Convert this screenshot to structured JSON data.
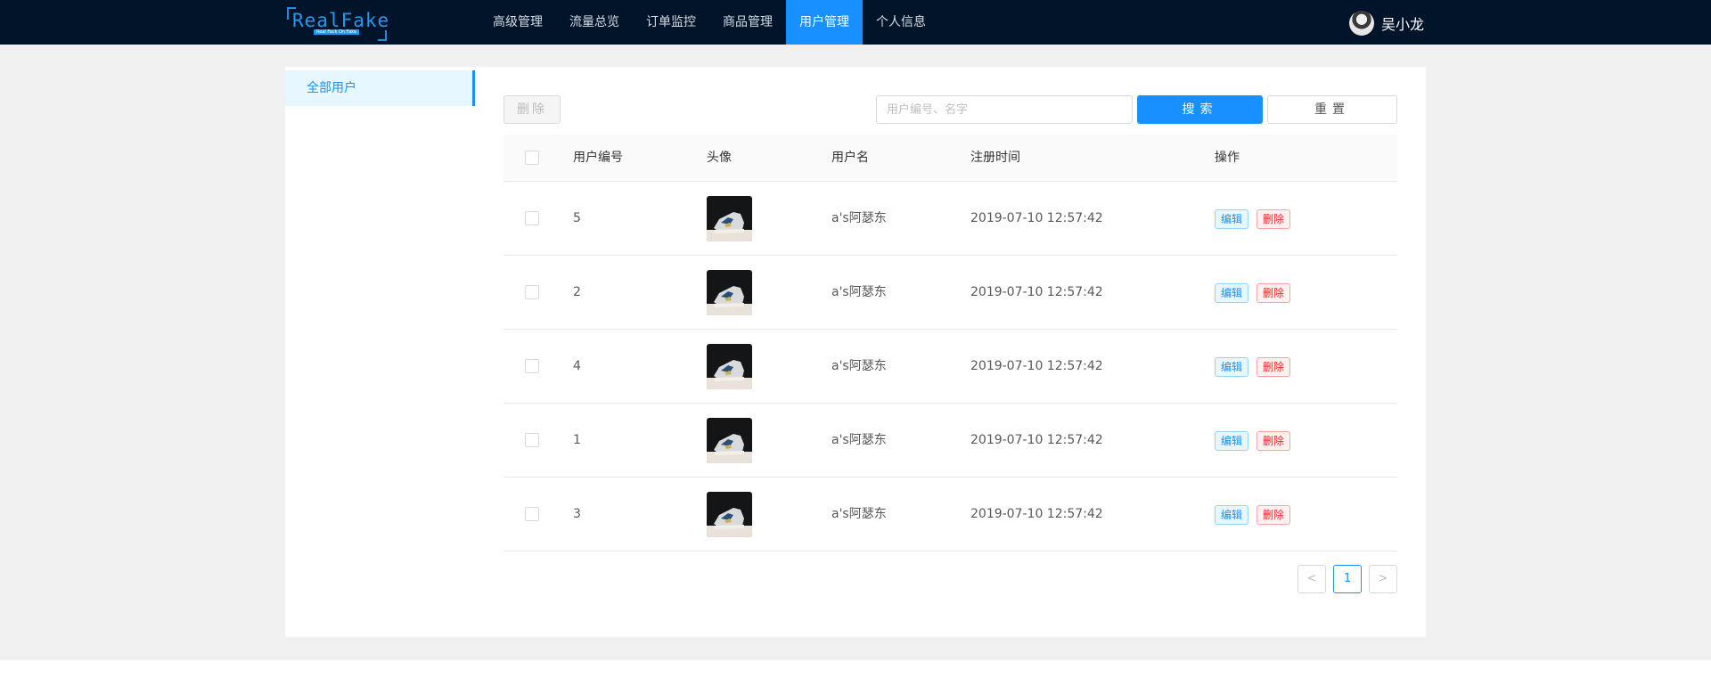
{
  "header": {
    "logo_text": "RealFake",
    "logo_subtext": "Real Fack On Fake",
    "nav": [
      {
        "label": "高级管理",
        "active": false
      },
      {
        "label": "流量总览",
        "active": false
      },
      {
        "label": "订单监控",
        "active": false
      },
      {
        "label": "商品管理",
        "active": false
      },
      {
        "label": "用户管理",
        "active": true
      },
      {
        "label": "个人信息",
        "active": false
      }
    ],
    "user_name": "吴小龙"
  },
  "sidebar": {
    "items": [
      {
        "label": "全部用户",
        "active": true
      }
    ]
  },
  "toolbar": {
    "delete_label": "删除",
    "search_placeholder": "用户编号、名字",
    "search_label": "搜索",
    "reset_label": "重置"
  },
  "table": {
    "columns": {
      "id": "用户编号",
      "avatar": "头像",
      "username": "用户名",
      "registered": "注册时间",
      "actions": "操作"
    },
    "rows": [
      {
        "id": "5",
        "username": "a's阿瑟东",
        "registered": "2019-07-10 12:57:42",
        "edit": "编辑",
        "delete": "删除"
      },
      {
        "id": "2",
        "username": "a's阿瑟东",
        "registered": "2019-07-10 12:57:42",
        "edit": "编辑",
        "delete": "删除"
      },
      {
        "id": "4",
        "username": "a's阿瑟东",
        "registered": "2019-07-10 12:57:42",
        "edit": "编辑",
        "delete": "删除"
      },
      {
        "id": "1",
        "username": "a's阿瑟东",
        "registered": "2019-07-10 12:57:42",
        "edit": "编辑",
        "delete": "删除"
      },
      {
        "id": "3",
        "username": "a's阿瑟东",
        "registered": "2019-07-10 12:57:42",
        "edit": "编辑",
        "delete": "删除"
      }
    ]
  },
  "pagination": {
    "prev": "<",
    "current": "1",
    "next": ">"
  },
  "colors": {
    "nav_bg": "#01142a",
    "accent": "#1890ff",
    "danger": "#f5222d"
  }
}
